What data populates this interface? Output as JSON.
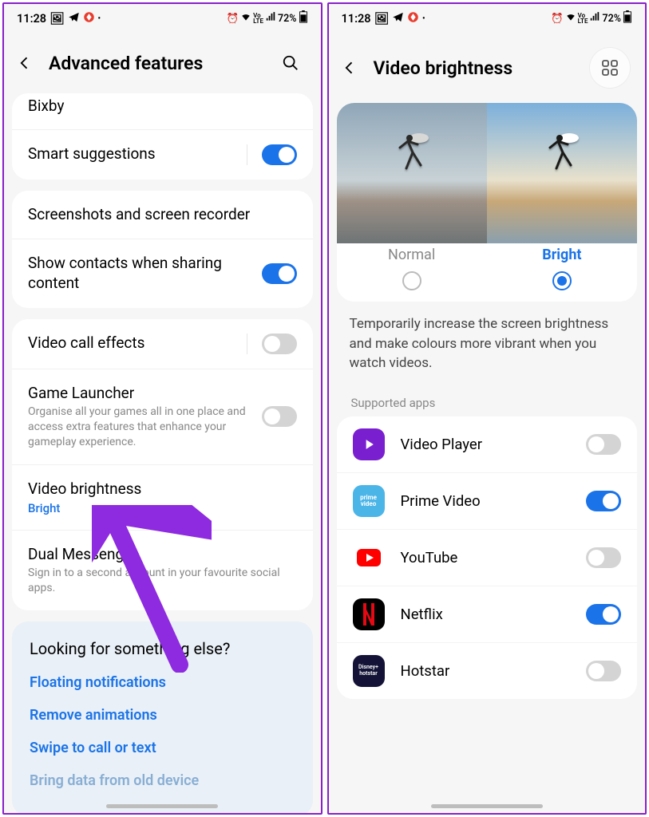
{
  "status_bar": {
    "time": "11:28",
    "icons_left": [
      "🖼",
      "✈",
      "◈",
      "•"
    ],
    "icons_right": [
      "⏰",
      "📶",
      "Vo LTE",
      "📶",
      "72%",
      "🔋"
    ],
    "battery_text": "72%"
  },
  "left": {
    "title": "Advanced features",
    "rows": {
      "bixby": "Bixby",
      "smart_suggestions": "Smart suggestions",
      "screenshots": "Screenshots and screen recorder",
      "show_contacts": "Show contacts when sharing content",
      "video_call": "Video call effects",
      "game_launcher": "Game Launcher",
      "game_launcher_sub": "Organise all your games all in one place and access extra features that enhance your gameplay experience.",
      "video_brightness": "Video brightness",
      "video_brightness_value": "Bright",
      "dual_messenger": "Dual Messenger",
      "dual_messenger_sub": "Sign in to a second account in your favourite social apps."
    },
    "toggles": {
      "smart_suggestions": true,
      "show_contacts": true,
      "video_call": false,
      "game_launcher": false
    },
    "suggest": {
      "title": "Looking for something else?",
      "links": [
        "Floating notifications",
        "Remove animations",
        "Swipe to call or text",
        "Bring data from old device"
      ]
    }
  },
  "right": {
    "title": "Video brightness",
    "modes": {
      "normal": "Normal",
      "bright": "Bright",
      "selected": "bright"
    },
    "description": "Temporarily increase the screen brightness and make colours more vibrant when you watch videos.",
    "supported_label": "Supported apps",
    "apps": [
      {
        "name": "Video Player",
        "on": false,
        "icon": "video"
      },
      {
        "name": "Prime Video",
        "on": true,
        "icon": "prime"
      },
      {
        "name": "YouTube",
        "on": false,
        "icon": "youtube"
      },
      {
        "name": "Netflix",
        "on": true,
        "icon": "netflix"
      },
      {
        "name": "Hotstar",
        "on": false,
        "icon": "hotstar"
      }
    ]
  }
}
